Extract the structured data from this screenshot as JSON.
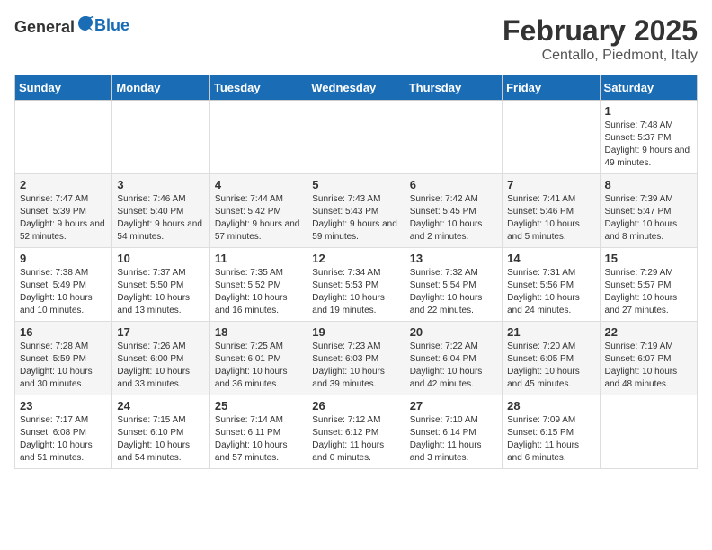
{
  "header": {
    "logo_general": "General",
    "logo_blue": "Blue",
    "month_year": "February 2025",
    "location": "Centallo, Piedmont, Italy"
  },
  "days_of_week": [
    "Sunday",
    "Monday",
    "Tuesday",
    "Wednesday",
    "Thursday",
    "Friday",
    "Saturday"
  ],
  "weeks": [
    [
      {
        "day": "",
        "info": ""
      },
      {
        "day": "",
        "info": ""
      },
      {
        "day": "",
        "info": ""
      },
      {
        "day": "",
        "info": ""
      },
      {
        "day": "",
        "info": ""
      },
      {
        "day": "",
        "info": ""
      },
      {
        "day": "1",
        "info": "Sunrise: 7:48 AM\nSunset: 5:37 PM\nDaylight: 9 hours and 49 minutes."
      }
    ],
    [
      {
        "day": "2",
        "info": "Sunrise: 7:47 AM\nSunset: 5:39 PM\nDaylight: 9 hours and 52 minutes."
      },
      {
        "day": "3",
        "info": "Sunrise: 7:46 AM\nSunset: 5:40 PM\nDaylight: 9 hours and 54 minutes."
      },
      {
        "day": "4",
        "info": "Sunrise: 7:44 AM\nSunset: 5:42 PM\nDaylight: 9 hours and 57 minutes."
      },
      {
        "day": "5",
        "info": "Sunrise: 7:43 AM\nSunset: 5:43 PM\nDaylight: 9 hours and 59 minutes."
      },
      {
        "day": "6",
        "info": "Sunrise: 7:42 AM\nSunset: 5:45 PM\nDaylight: 10 hours and 2 minutes."
      },
      {
        "day": "7",
        "info": "Sunrise: 7:41 AM\nSunset: 5:46 PM\nDaylight: 10 hours and 5 minutes."
      },
      {
        "day": "8",
        "info": "Sunrise: 7:39 AM\nSunset: 5:47 PM\nDaylight: 10 hours and 8 minutes."
      }
    ],
    [
      {
        "day": "9",
        "info": "Sunrise: 7:38 AM\nSunset: 5:49 PM\nDaylight: 10 hours and 10 minutes."
      },
      {
        "day": "10",
        "info": "Sunrise: 7:37 AM\nSunset: 5:50 PM\nDaylight: 10 hours and 13 minutes."
      },
      {
        "day": "11",
        "info": "Sunrise: 7:35 AM\nSunset: 5:52 PM\nDaylight: 10 hours and 16 minutes."
      },
      {
        "day": "12",
        "info": "Sunrise: 7:34 AM\nSunset: 5:53 PM\nDaylight: 10 hours and 19 minutes."
      },
      {
        "day": "13",
        "info": "Sunrise: 7:32 AM\nSunset: 5:54 PM\nDaylight: 10 hours and 22 minutes."
      },
      {
        "day": "14",
        "info": "Sunrise: 7:31 AM\nSunset: 5:56 PM\nDaylight: 10 hours and 24 minutes."
      },
      {
        "day": "15",
        "info": "Sunrise: 7:29 AM\nSunset: 5:57 PM\nDaylight: 10 hours and 27 minutes."
      }
    ],
    [
      {
        "day": "16",
        "info": "Sunrise: 7:28 AM\nSunset: 5:59 PM\nDaylight: 10 hours and 30 minutes."
      },
      {
        "day": "17",
        "info": "Sunrise: 7:26 AM\nSunset: 6:00 PM\nDaylight: 10 hours and 33 minutes."
      },
      {
        "day": "18",
        "info": "Sunrise: 7:25 AM\nSunset: 6:01 PM\nDaylight: 10 hours and 36 minutes."
      },
      {
        "day": "19",
        "info": "Sunrise: 7:23 AM\nSunset: 6:03 PM\nDaylight: 10 hours and 39 minutes."
      },
      {
        "day": "20",
        "info": "Sunrise: 7:22 AM\nSunset: 6:04 PM\nDaylight: 10 hours and 42 minutes."
      },
      {
        "day": "21",
        "info": "Sunrise: 7:20 AM\nSunset: 6:05 PM\nDaylight: 10 hours and 45 minutes."
      },
      {
        "day": "22",
        "info": "Sunrise: 7:19 AM\nSunset: 6:07 PM\nDaylight: 10 hours and 48 minutes."
      }
    ],
    [
      {
        "day": "23",
        "info": "Sunrise: 7:17 AM\nSunset: 6:08 PM\nDaylight: 10 hours and 51 minutes."
      },
      {
        "day": "24",
        "info": "Sunrise: 7:15 AM\nSunset: 6:10 PM\nDaylight: 10 hours and 54 minutes."
      },
      {
        "day": "25",
        "info": "Sunrise: 7:14 AM\nSunset: 6:11 PM\nDaylight: 10 hours and 57 minutes."
      },
      {
        "day": "26",
        "info": "Sunrise: 7:12 AM\nSunset: 6:12 PM\nDaylight: 11 hours and 0 minutes."
      },
      {
        "day": "27",
        "info": "Sunrise: 7:10 AM\nSunset: 6:14 PM\nDaylight: 11 hours and 3 minutes."
      },
      {
        "day": "28",
        "info": "Sunrise: 7:09 AM\nSunset: 6:15 PM\nDaylight: 11 hours and 6 minutes."
      },
      {
        "day": "",
        "info": ""
      }
    ]
  ]
}
